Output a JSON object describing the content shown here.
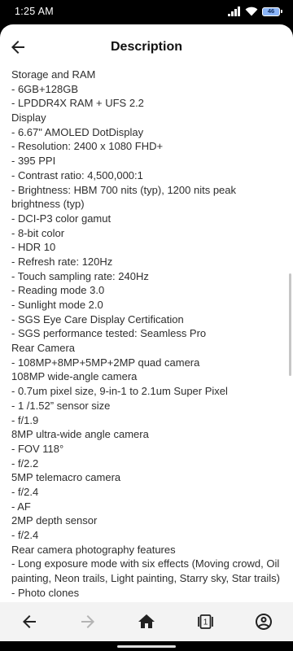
{
  "status_bar": {
    "time": "1:25 AM",
    "battery_level": "46",
    "icons": [
      "signal-icon",
      "wifi-icon",
      "battery-icon"
    ]
  },
  "header": {
    "title": "Description",
    "back_icon": "arrow-left-icon"
  },
  "content": {
    "lines": [
      "Storage and RAM",
      "- 6GB+128GB",
      "- LPDDR4X RAM + UFS 2.2",
      "Display",
      "- 6.67\" AMOLED DotDisplay",
      "- Resolution: 2400 x 1080 FHD+",
      "- 395 PPI",
      "- Contrast ratio: 4,500,000:1",
      "- Brightness: HBM 700 nits (typ), 1200 nits peak",
      "brightness (typ)",
      "- DCI-P3 color gamut",
      "- 8-bit color",
      "- HDR 10",
      "- Refresh rate: 120Hz",
      "- Touch sampling rate: 240Hz",
      "- Reading mode 3.0",
      "- Sunlight mode 2.0",
      "- SGS Eye Care Display Certification",
      "- SGS performance tested: Seamless Pro",
      "Rear Camera",
      "- 108MP+8MP+5MP+2MP quad camera",
      "108MP wide-angle camera",
      "- 0.7um pixel size, 9-in-1 to 2.1um Super Pixel",
      "- 1 /1.52” sensor size",
      "- f/1.9",
      "8MP ultra-wide angle camera",
      "- FOV 118°",
      "- f/2.2",
      "5MP telemacro camera",
      "- f/2.4",
      "- AF",
      "2MP depth sensor",
      "- f/2.4",
      "Rear camera photography features",
      "- Long exposure mode with six effects (Moving crowd, Oil",
      "painting, Neon trails, Light painting, Starry sky, Star trails)",
      "- Photo clones"
    ]
  },
  "bottom_nav": {
    "tab_count": "1",
    "items": [
      {
        "icon": "back-arrow-icon",
        "disabled": false
      },
      {
        "icon": "forward-arrow-icon",
        "disabled": true
      },
      {
        "icon": "home-icon",
        "disabled": false
      },
      {
        "icon": "tabs-icon",
        "disabled": false
      },
      {
        "icon": "account-icon",
        "disabled": false
      }
    ]
  },
  "colors": {
    "text": "#2e2e2e",
    "title": "#111111",
    "nav_bg": "#f3f3f3",
    "disabled": "#b4b4b4",
    "icon": "#222222",
    "battery": "#8ab4f8"
  }
}
